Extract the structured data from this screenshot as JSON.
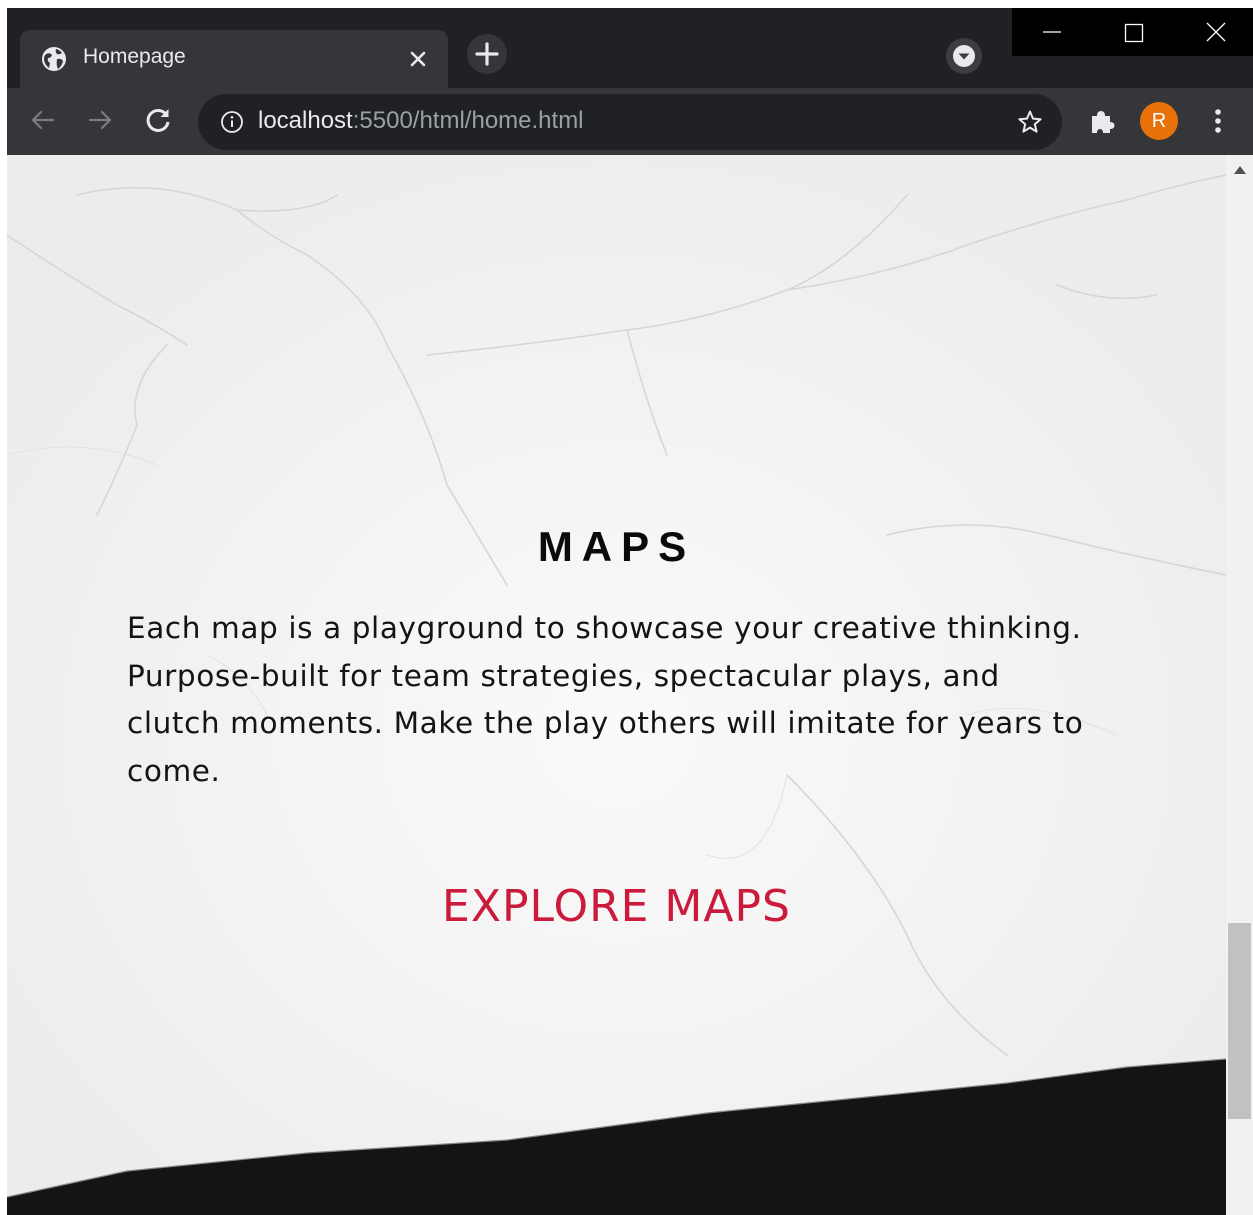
{
  "browser": {
    "tab": {
      "title": "Homepage",
      "favicon": "globe-icon",
      "close_icon": "close-icon"
    },
    "new_tab_icon": "plus-icon",
    "tab_search_icon": "chevron-down-icon",
    "window_controls": [
      "minimize-icon",
      "maximize-icon",
      "close-icon"
    ],
    "nav": {
      "back_icon": "arrow-left-icon",
      "forward_icon": "arrow-right-icon",
      "reload_icon": "reload-icon"
    },
    "address": {
      "info_icon": "info-icon",
      "host": "localhost",
      "rest": ":5500/html/home.html"
    },
    "bookmark_icon": "star-icon",
    "extensions_icon": "puzzle-icon",
    "profile": {
      "initial": "R",
      "color": "#e8710a"
    },
    "menu_icon": "more-vertical-icon"
  },
  "page": {
    "title": "MAPS",
    "description": "Each map is a playground to showcase your creative thinking. Purpose-built for team strategies, spectacular plays, and clutch moments. Make the play others will imitate for years to come.",
    "cta": "EXPLORE MAPS",
    "colors": {
      "cta": "#cc1a3d",
      "text": "#141414",
      "background": "#f3f3f3",
      "band": "#141414"
    }
  }
}
